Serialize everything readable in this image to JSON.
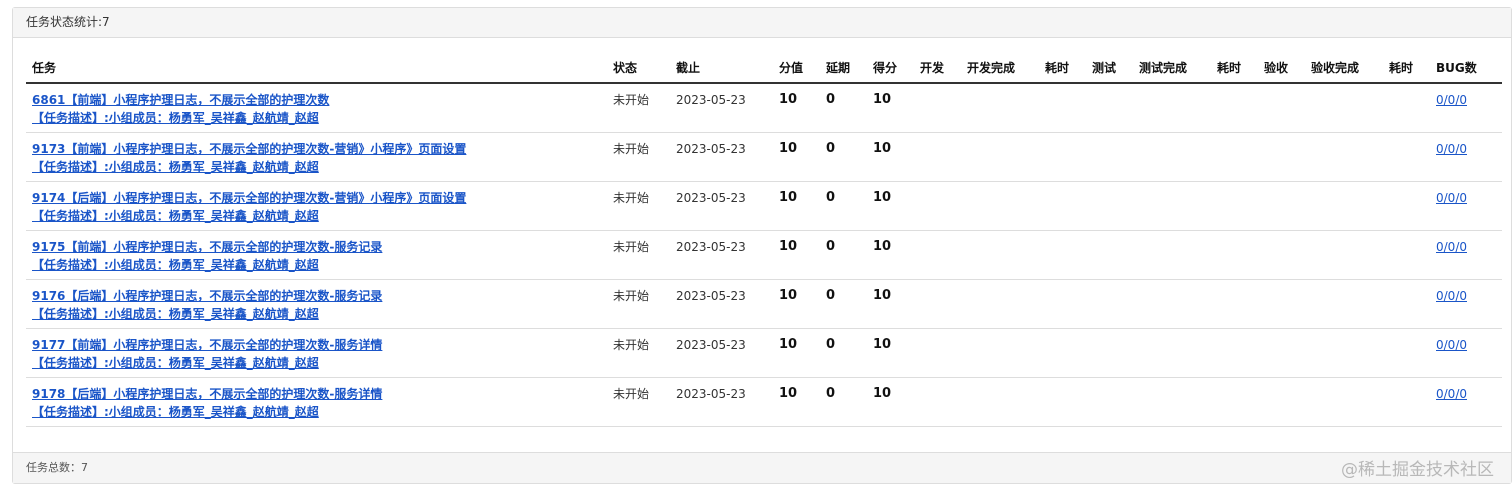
{
  "panel": {
    "heading": "任务状态统计:7",
    "footer": "任务总数：7"
  },
  "columns": [
    "任务",
    "状态",
    "截止",
    "分值",
    "延期",
    "得分",
    "开发",
    "开发完成",
    "耗时",
    "测试",
    "测试完成",
    "耗时",
    "验收",
    "验收完成",
    "耗时",
    "BUG数"
  ],
  "rows": [
    {
      "title": "6861【前端】小程序护理日志，不展示全部的护理次数",
      "desc": "【任务描述】:小组成员：杨勇军_吴祥鑫_赵航靖_赵超",
      "status": "未开始",
      "deadline": "2023-05-23",
      "score": "10",
      "delay": "0",
      "got": "10",
      "bug": "0/0/0"
    },
    {
      "title": "9173【前端】小程序护理日志，不展示全部的护理次数-营销》小程序》页面设置",
      "desc": "【任务描述】:小组成员：杨勇军_吴祥鑫_赵航靖_赵超",
      "status": "未开始",
      "deadline": "2023-05-23",
      "score": "10",
      "delay": "0",
      "got": "10",
      "bug": "0/0/0"
    },
    {
      "title": "9174【后端】小程序护理日志，不展示全部的护理次数-营销》小程序》页面设置",
      "desc": "【任务描述】:小组成员：杨勇军_吴祥鑫_赵航靖_赵超",
      "status": "未开始",
      "deadline": "2023-05-23",
      "score": "10",
      "delay": "0",
      "got": "10",
      "bug": "0/0/0"
    },
    {
      "title": "9175【前端】小程序护理日志，不展示全部的护理次数-服务记录",
      "desc": "【任务描述】:小组成员：杨勇军_吴祥鑫_赵航靖_赵超",
      "status": "未开始",
      "deadline": "2023-05-23",
      "score": "10",
      "delay": "0",
      "got": "10",
      "bug": "0/0/0"
    },
    {
      "title": "9176【后端】小程序护理日志，不展示全部的护理次数-服务记录",
      "desc": "【任务描述】:小组成员：杨勇军_吴祥鑫_赵航靖_赵超",
      "status": "未开始",
      "deadline": "2023-05-23",
      "score": "10",
      "delay": "0",
      "got": "10",
      "bug": "0/0/0"
    },
    {
      "title": "9177【前端】小程序护理日志，不展示全部的护理次数-服务详情",
      "desc": "【任务描述】:小组成员：杨勇军_吴祥鑫_赵航靖_赵超",
      "status": "未开始",
      "deadline": "2023-05-23",
      "score": "10",
      "delay": "0",
      "got": "10",
      "bug": "0/0/0"
    },
    {
      "title": "9178【后端】小程序护理日志，不展示全部的护理次数-服务详情",
      "desc": "【任务描述】:小组成员：杨勇军_吴祥鑫_赵航靖_赵超",
      "status": "未开始",
      "deadline": "2023-05-23",
      "score": "10",
      "delay": "0",
      "got": "10",
      "bug": "0/0/0"
    }
  ],
  "watermark": "@稀土掘金技术社区"
}
